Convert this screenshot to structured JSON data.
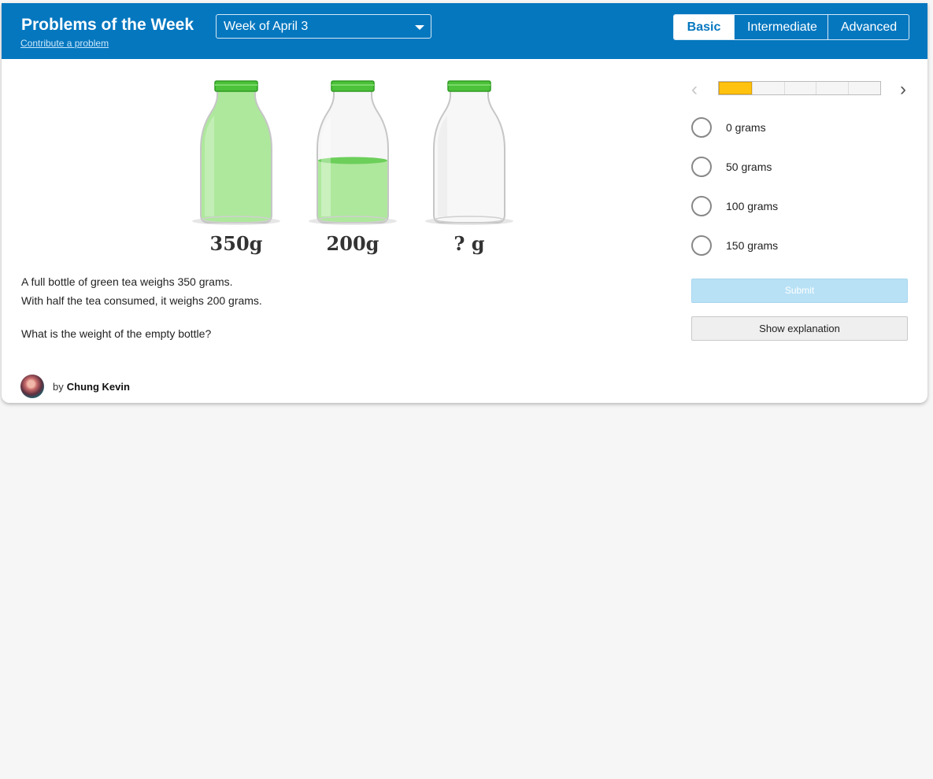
{
  "header": {
    "title": "Problems of the Week",
    "contribute_link": "Contribute a problem",
    "week_select": "Week of April 3",
    "levels": [
      "Basic",
      "Intermediate",
      "Advanced"
    ],
    "active_level": "Basic"
  },
  "figure": {
    "bottles": [
      {
        "label": "350g",
        "fill": 1.0
      },
      {
        "label": "200g",
        "fill": 0.5
      },
      {
        "label": "? g",
        "fill": 0
      }
    ],
    "tea_color": "#aee89c",
    "cap_color": "#4cc13a"
  },
  "problem": {
    "line1": "A full bottle of green tea weighs 350 grams.",
    "line2": "With half the tea consumed, it weighs 200 grams.",
    "question": "What is the weight of the empty bottle?"
  },
  "author": {
    "by": "by",
    "name": "Chung Kevin"
  },
  "navigator": {
    "total_problems": 5,
    "current_problem": 1
  },
  "choices": [
    "0 grams",
    "50 grams",
    "100 grams",
    "150 grams"
  ],
  "buttons": {
    "submit": "Submit",
    "explanation": "Show explanation"
  },
  "colors": {
    "header": "#0477bf",
    "progress_current": "#ffc20e",
    "submit_disabled": "#b8e1f6"
  }
}
